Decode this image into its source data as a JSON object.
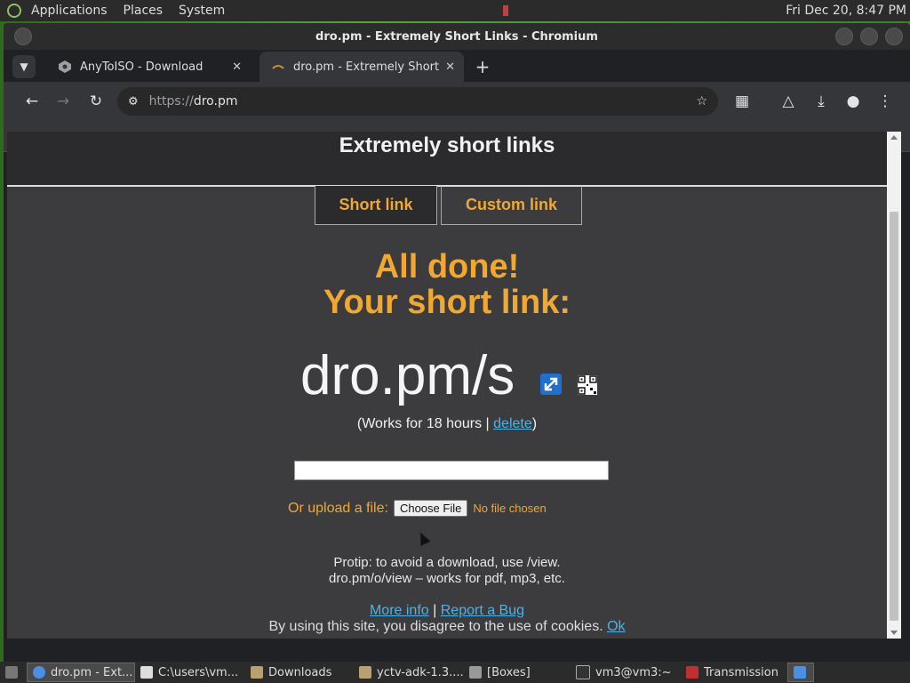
{
  "top_panel": {
    "menus": [
      "Applications",
      "Places",
      "System"
    ],
    "clock": "Fri Dec 20,  8:47 PM"
  },
  "window": {
    "title": "dro.pm - Extremely Short Links - Chromium"
  },
  "tabs": [
    {
      "label": "AnyToISO - Download",
      "active": false
    },
    {
      "label": "dro.pm - Extremely Short Links",
      "active": true
    }
  ],
  "toolbar": {
    "url_scheme": "https://",
    "url_host": "dro.pm"
  },
  "page": {
    "header_title": "Extremely short links",
    "mode_tabs": [
      "Short link",
      "Custom link"
    ],
    "done_line1": "All done!",
    "done_line2": "Your short link:",
    "short_link": "dro.pm/s",
    "works_prefix": "(Works for 18 hours | ",
    "works_delete": "delete",
    "works_suffix": ")",
    "upload_label": "Or upload a file:",
    "choose_file": "Choose File",
    "no_file": "No file chosen",
    "protip_line1": "Protip: to avoid a download, use /view.",
    "protip_line2": "dro.pm/o/view – works for pdf, mp3, etc.",
    "more_info": "More info",
    "separator": "|",
    "report_bug": "Report a Bug",
    "cookie_text": "By using this site, you disagree to the use of cookies.",
    "cookie_ok": "Ok"
  },
  "taskbar": {
    "items": [
      {
        "label": "dro.pm - Ext...",
        "active": true
      },
      {
        "label": "C:\\users\\vm...",
        "active": false
      },
      {
        "label": "Downloads",
        "active": false
      },
      {
        "label": "yctv-adk-1.3....",
        "active": false
      },
      {
        "label": "[Boxes]",
        "active": false
      },
      {
        "label": "vm3@vm3:~",
        "active": false
      },
      {
        "label": "Transmission",
        "active": false
      }
    ]
  },
  "colors": {
    "accent_orange": "#f0a830",
    "link_blue": "#4ab4e6",
    "page_bg": "#3c3c3f"
  }
}
